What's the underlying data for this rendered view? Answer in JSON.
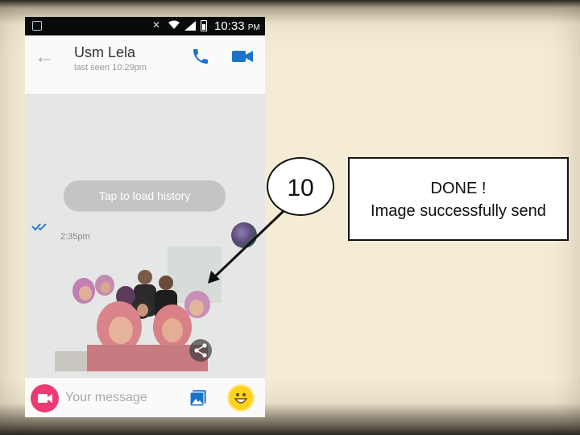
{
  "status_bar": {
    "time": "10:33",
    "ampm": "PM",
    "icons": [
      "notification-icon",
      "mute-icon",
      "wifi-icon",
      "signal-icon",
      "battery-icon"
    ]
  },
  "header": {
    "contact_name": "Usm Lela",
    "last_seen": "last seen 10:29pm",
    "icons": [
      "back-arrow-icon",
      "phone-icon",
      "video-camera-icon"
    ],
    "accent_color": "#1a73c9"
  },
  "chat": {
    "load_history_label": "Tap to load history",
    "message_time": "2:35pm",
    "message_type": "image",
    "status_icon": "double-check-icon"
  },
  "input_bar": {
    "placeholder": "Your message",
    "icons": [
      "video-message-icon",
      "gallery-icon",
      "emoji-icon"
    ],
    "video_button_color": "#ec3b73",
    "emoji_color": "#ffd21f"
  },
  "annotation": {
    "step_number": "10",
    "note_line1": "DONE !",
    "note_line2": "Image successfully send"
  }
}
